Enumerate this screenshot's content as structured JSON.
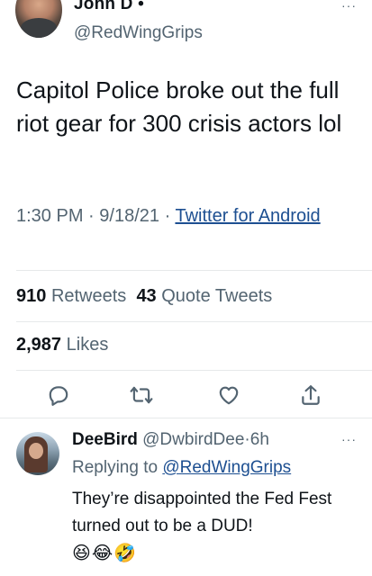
{
  "tweet": {
    "display_name": "John D",
    "name_badge": "•",
    "handle": "@RedWingGrips",
    "more": "···",
    "text": "Capitol Police broke out the full riot gear for 300 crisis actors lol",
    "time": "1:30 PM",
    "date": "9/18/21",
    "separator": "·",
    "source": "Twitter for Android"
  },
  "stats": {
    "retweets_count": "910",
    "retweets_label": "Retweets",
    "quotes_count": "43",
    "quotes_label": "Quote Tweets",
    "likes_count": "2,987",
    "likes_label": "Likes"
  },
  "actions": {
    "icons": [
      "reply-icon",
      "retweet-icon",
      "like-icon",
      "share-icon"
    ]
  },
  "reply": {
    "display_name": "DeeBird",
    "handle": "@DwbirdDee",
    "separator": "·",
    "age": "6h",
    "more": "···",
    "replying_prefix": "Replying to",
    "replying_to": "@RedWingGrips",
    "text": "They’re disappointed the Fed Fest turned out to be a DUD!",
    "emojis": "😆😂🤣"
  },
  "colors": {
    "text": "#0f1419",
    "secondary": "#536471",
    "link": "#1d4f91",
    "divider": "#e6e9ea"
  }
}
